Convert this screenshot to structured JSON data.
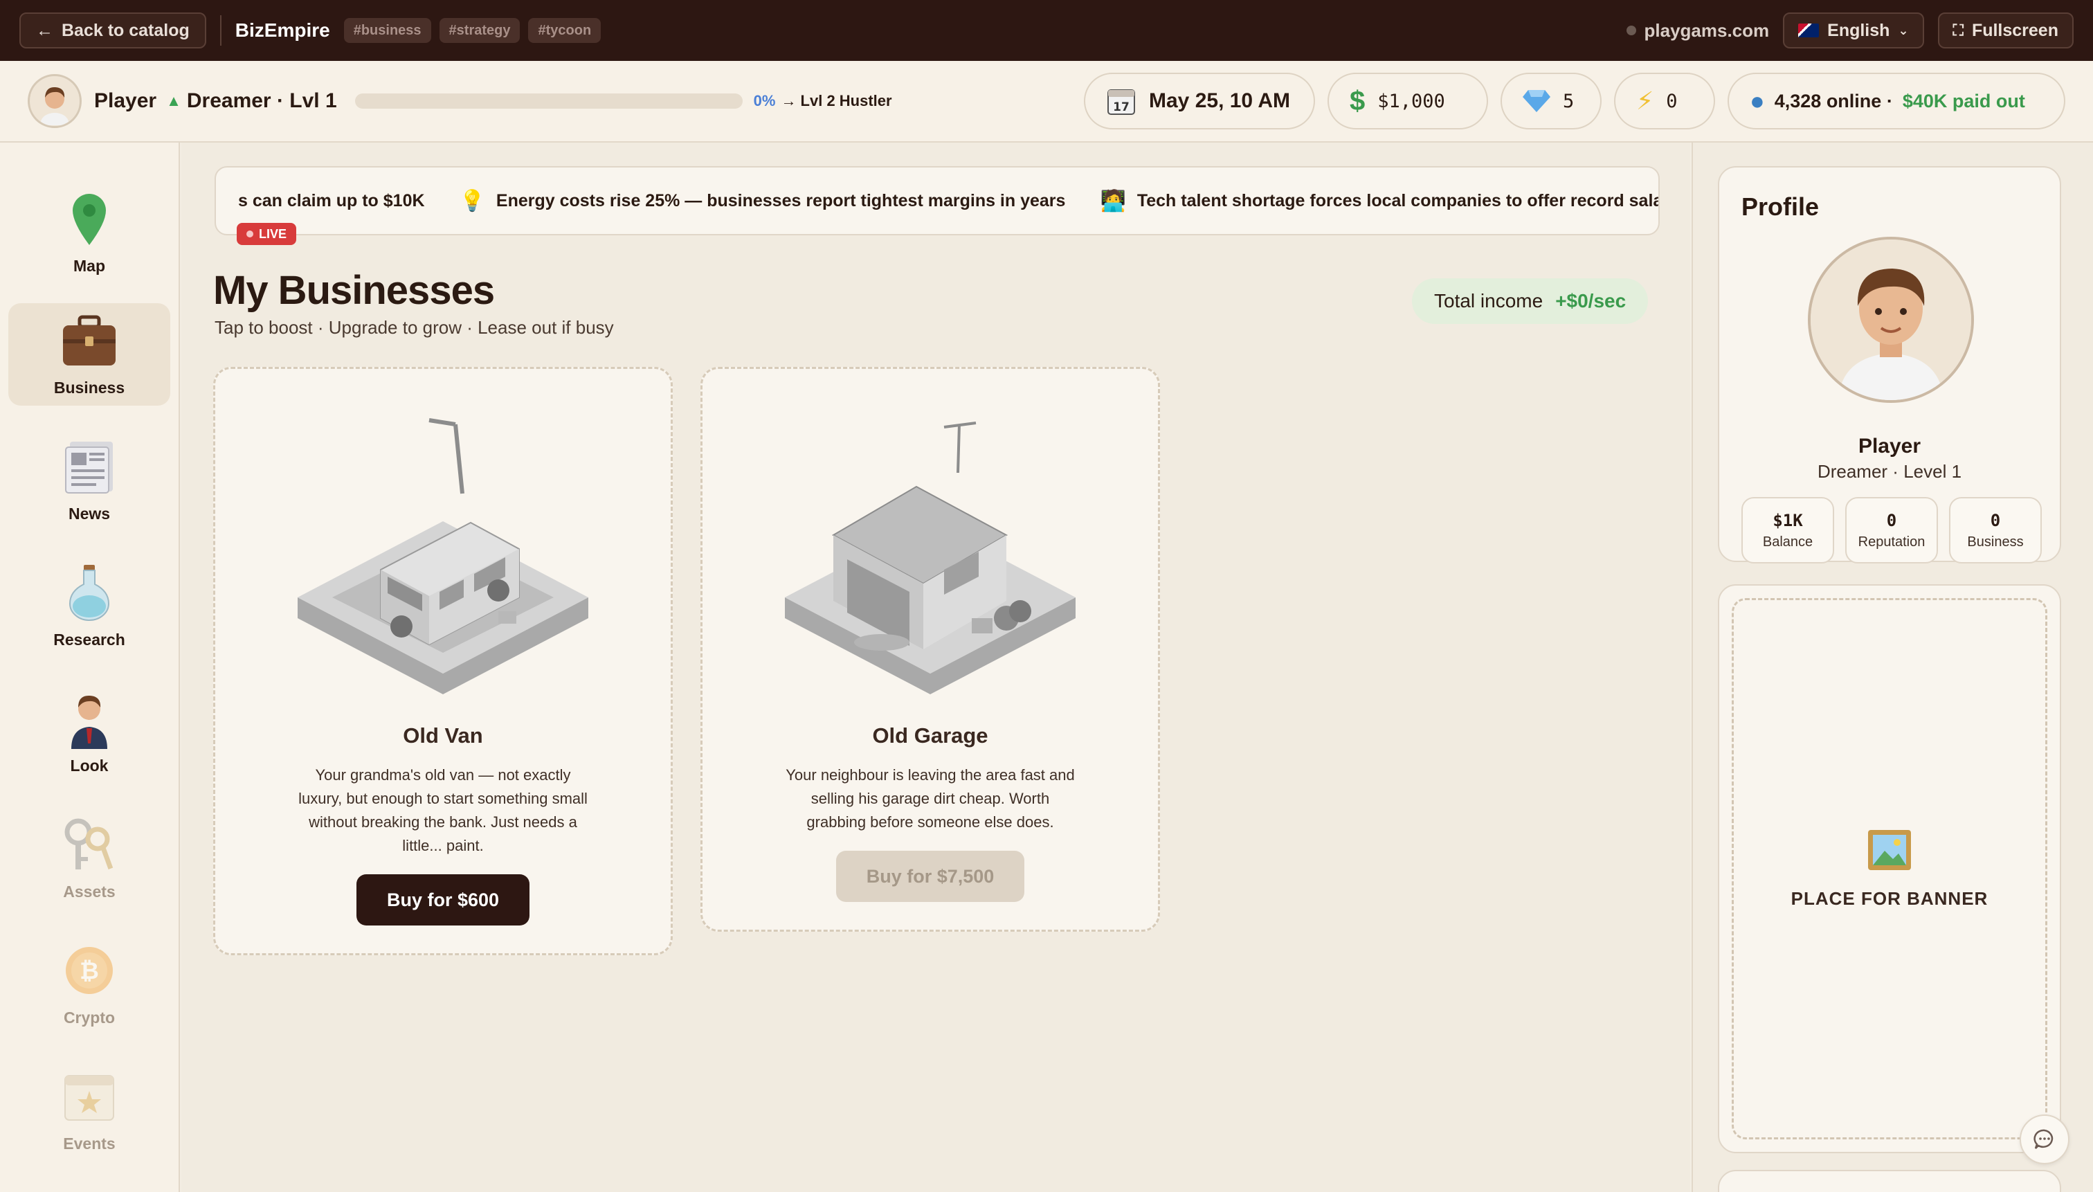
{
  "topbar": {
    "back_label": "Back to catalog",
    "app_title": "BizEmpire",
    "tags": [
      "#business",
      "#strategy",
      "#tycoon"
    ],
    "site": "playgams.com",
    "language": "English",
    "fullscreen_label": "Fullscreen"
  },
  "player": {
    "name": "Player",
    "rank": "Dreamer · Lvl 1",
    "xp_percent": "0%",
    "xp_progress": 0,
    "next_level": "→ Lvl 2 Hustler",
    "date": "May 25, 10 AM",
    "calendar_day": "17",
    "money": "$1,000",
    "gems": "5",
    "energy": "0",
    "online": "4,328 online ·",
    "paid_out": "$40K paid out"
  },
  "sidebar": {
    "items": [
      {
        "label": "Map",
        "icon": "map-pin-icon"
      },
      {
        "label": "Business",
        "icon": "briefcase-icon"
      },
      {
        "label": "News",
        "icon": "newspaper-icon"
      },
      {
        "label": "Research",
        "icon": "flask-icon"
      },
      {
        "label": "Look",
        "icon": "person-icon"
      },
      {
        "label": "Assets",
        "icon": "keys-icon"
      },
      {
        "label": "Crypto",
        "icon": "bitcoin-icon"
      },
      {
        "label": "Events",
        "icon": "calendar-star-icon"
      }
    ]
  },
  "ticker": {
    "items": [
      "s can claim up to $10K",
      "Energy costs rise 25% — businesses report tightest margins in years",
      "Tech talent shortage forces local companies to offer record salari"
    ],
    "live_label": "LIVE"
  },
  "main": {
    "title": "My Businesses",
    "subtitle": "Tap to boost · Upgrade to grow · Lease out if busy",
    "income_label": "Total income",
    "income_value": "+$0/sec",
    "cards": [
      {
        "title": "Old Van",
        "desc": "Your grandma's old van — not exactly luxury, but enough to start something small without breaking the bank. Just needs a little... paint.",
        "button": "Buy for $600",
        "enabled": true
      },
      {
        "title": "Old Garage",
        "desc": "Your neighbour is leaving the area fast and selling his garage dirt cheap. Worth grabbing before someone else does.",
        "button": "Buy for $7,500",
        "enabled": false
      }
    ]
  },
  "profile": {
    "title": "Profile",
    "name": "Player",
    "rank": "Dreamer · Level 1",
    "stats": [
      {
        "value": "$1K",
        "label": "Balance"
      },
      {
        "value": "0",
        "label": "Reputation"
      },
      {
        "value": "0",
        "label": "Business"
      }
    ]
  },
  "banner": {
    "text": "PLACE FOR BANNER"
  },
  "colors": {
    "topbar": "#2d1712",
    "accent_green": "#3a9a4c",
    "live_red": "#d83b3b",
    "xp_blue": "#4a7fd6"
  }
}
